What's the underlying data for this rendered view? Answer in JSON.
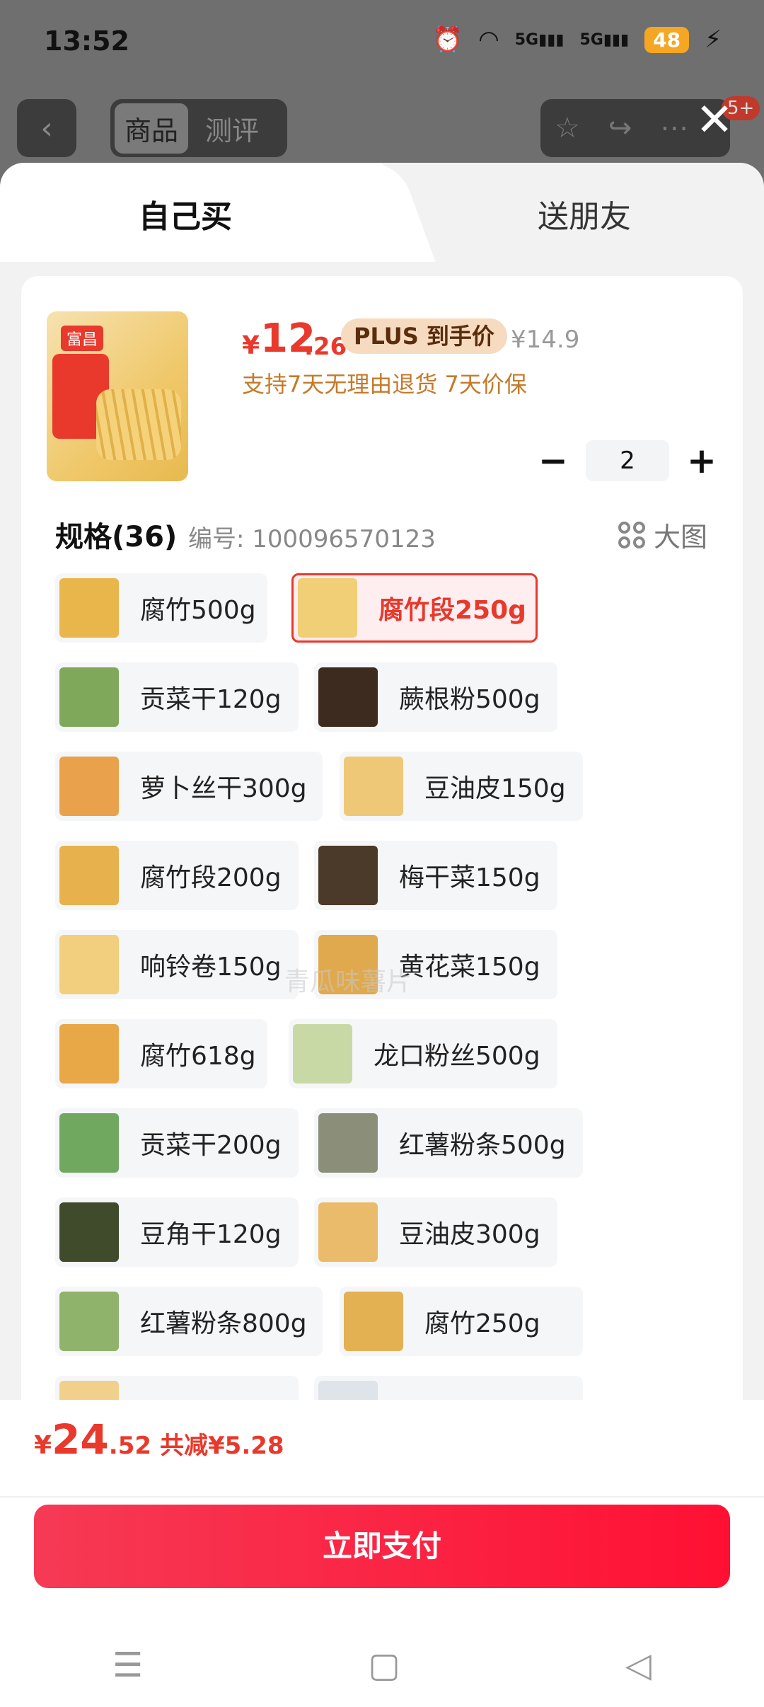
{
  "status_bar": {
    "time": "13:52",
    "signal_labels": [
      "5G",
      "5G"
    ],
    "battery": "48"
  },
  "background": {
    "tabs": [
      {
        "label": "商品"
      },
      {
        "label": "测评"
      }
    ],
    "cart_badge": "5+"
  },
  "modes": {
    "self": "自己买",
    "gift": "送朋友"
  },
  "product": {
    "brand_mark": "富昌",
    "price_currency": "¥",
    "price_int": "12",
    "price_dec": ".26",
    "plus_label": "PLUS 到手价",
    "original_price": "¥14.9",
    "promise": "支持7天无理由退货  7天价保",
    "quantity": "2"
  },
  "specs_header": {
    "title": "规格(36)",
    "code": "编号: 100096570123",
    "big_pic": "大图"
  },
  "specs": [
    {
      "name": "腐竹500g",
      "color": "#e8b64a"
    },
    {
      "name": "腐竹段250g",
      "color": "#f0cf76",
      "selected": true
    },
    {
      "name": "贡菜干120g",
      "color": "#7fa85a"
    },
    {
      "name": "蕨根粉500g",
      "color": "#3d2b1f"
    },
    {
      "name": "萝卜丝干300g",
      "color": "#e9a24b"
    },
    {
      "name": "豆油皮150g",
      "color": "#efc877"
    },
    {
      "name": "腐竹段200g",
      "color": "#e7b24d"
    },
    {
      "name": "梅干菜150g",
      "color": "#4b3a2a"
    },
    {
      "name": "响铃卷150g",
      "color": "#f1cf7f"
    },
    {
      "name": "黄花菜150g",
      "color": "#e0a94d"
    },
    {
      "name": "腐竹618g",
      "color": "#e8a848"
    },
    {
      "name": "龙口粉丝500g",
      "color": "#c9d9a6"
    },
    {
      "name": "贡菜干200g",
      "color": "#6fa85e"
    },
    {
      "name": "红薯粉条500g",
      "color": "#8b8f7a"
    },
    {
      "name": "豆角干120g",
      "color": "#3f4b2a"
    },
    {
      "name": "豆油皮300g",
      "color": "#e9bb6b"
    },
    {
      "name": "红薯粉条800g",
      "color": "#8fb36a"
    },
    {
      "name": "腐竹250g",
      "color": "#e3b152"
    }
  ],
  "watermark": "青瓜味薯片",
  "footer": {
    "currency": "¥",
    "total_int": "24",
    "total_dec": ".52",
    "savings": "共减¥5.28",
    "pay_label": "立即支付"
  }
}
